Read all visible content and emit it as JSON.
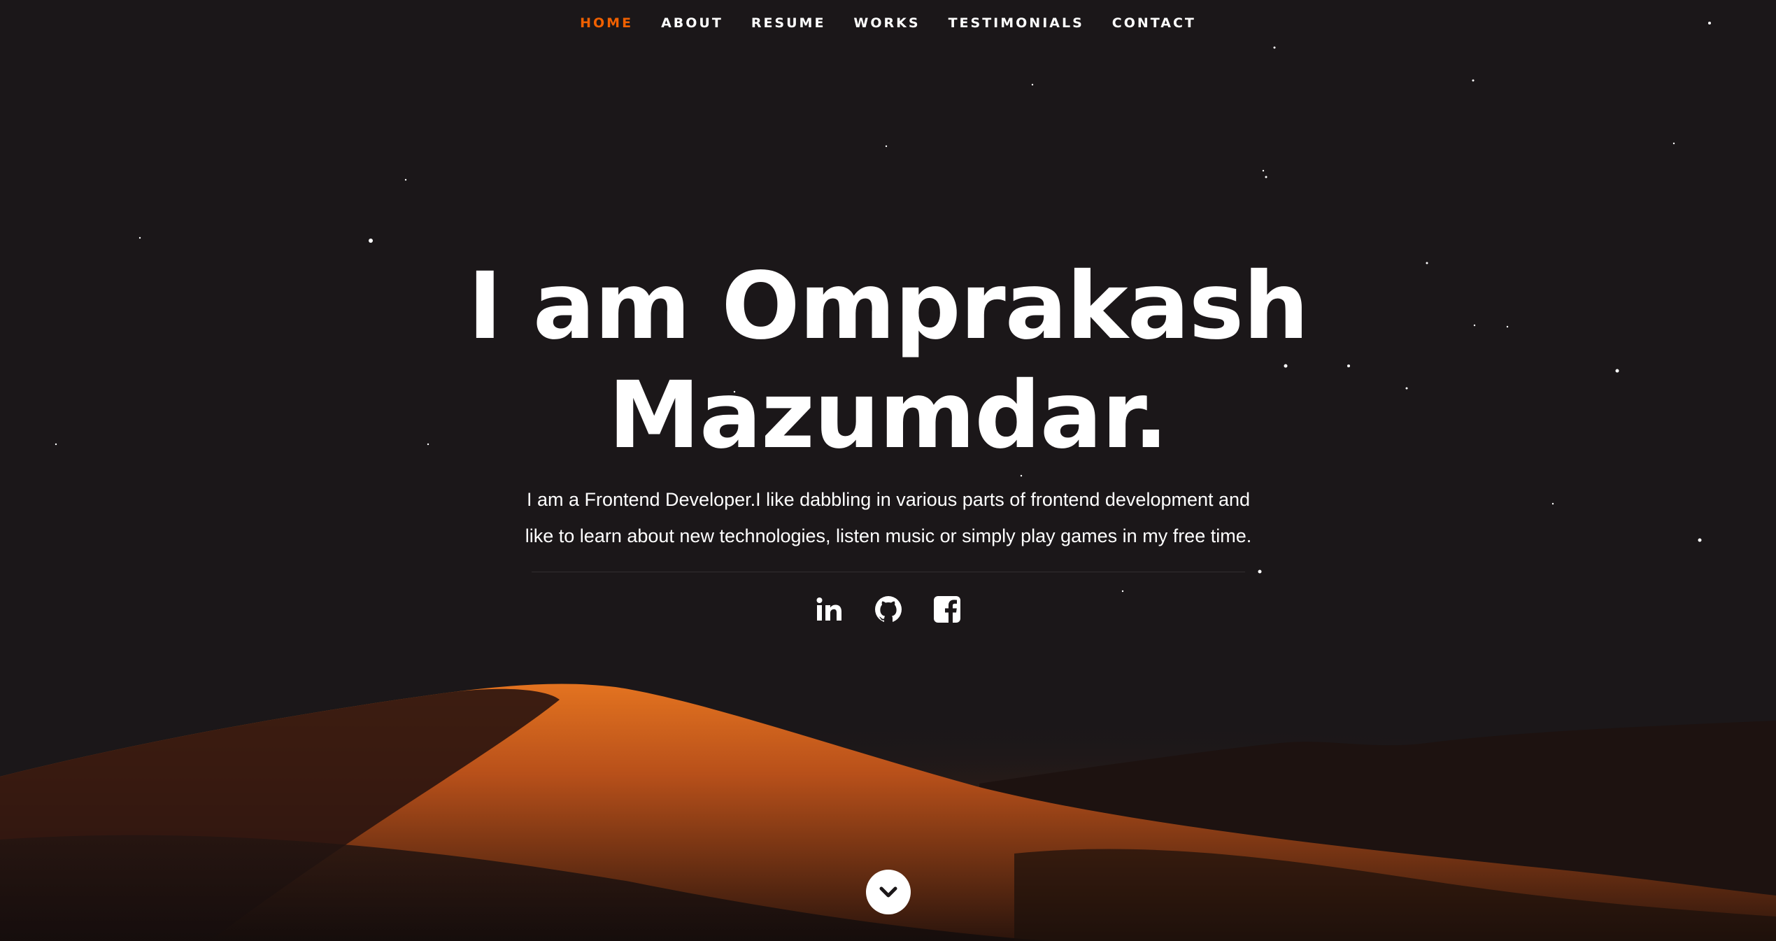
{
  "nav": {
    "items": [
      {
        "label": "HOME",
        "active": true
      },
      {
        "label": "ABOUT",
        "active": false
      },
      {
        "label": "RESUME",
        "active": false
      },
      {
        "label": "WORKS",
        "active": false
      },
      {
        "label": "TESTIMONIALS",
        "active": false
      },
      {
        "label": "CONTACT",
        "active": false
      }
    ],
    "active_color": "#f06000",
    "text_color": "#ffffff"
  },
  "hero": {
    "headline_line1": "I am Omprakash",
    "headline_line2": "Mazumdar.",
    "intro_line1": "I am a Frontend Developer.I like dabbling in various parts of frontend development and",
    "intro_line2": "like to learn about new technologies, listen music or simply play games in my free time."
  },
  "social": [
    {
      "icon": "linkedin-icon"
    },
    {
      "icon": "github-icon"
    },
    {
      "icon": "facebook-icon"
    }
  ],
  "scroll": {
    "icon": "chevron-down-icon"
  },
  "colors": {
    "accent": "#f06000",
    "background": "#1a1719",
    "dune": "#e0681a"
  }
}
